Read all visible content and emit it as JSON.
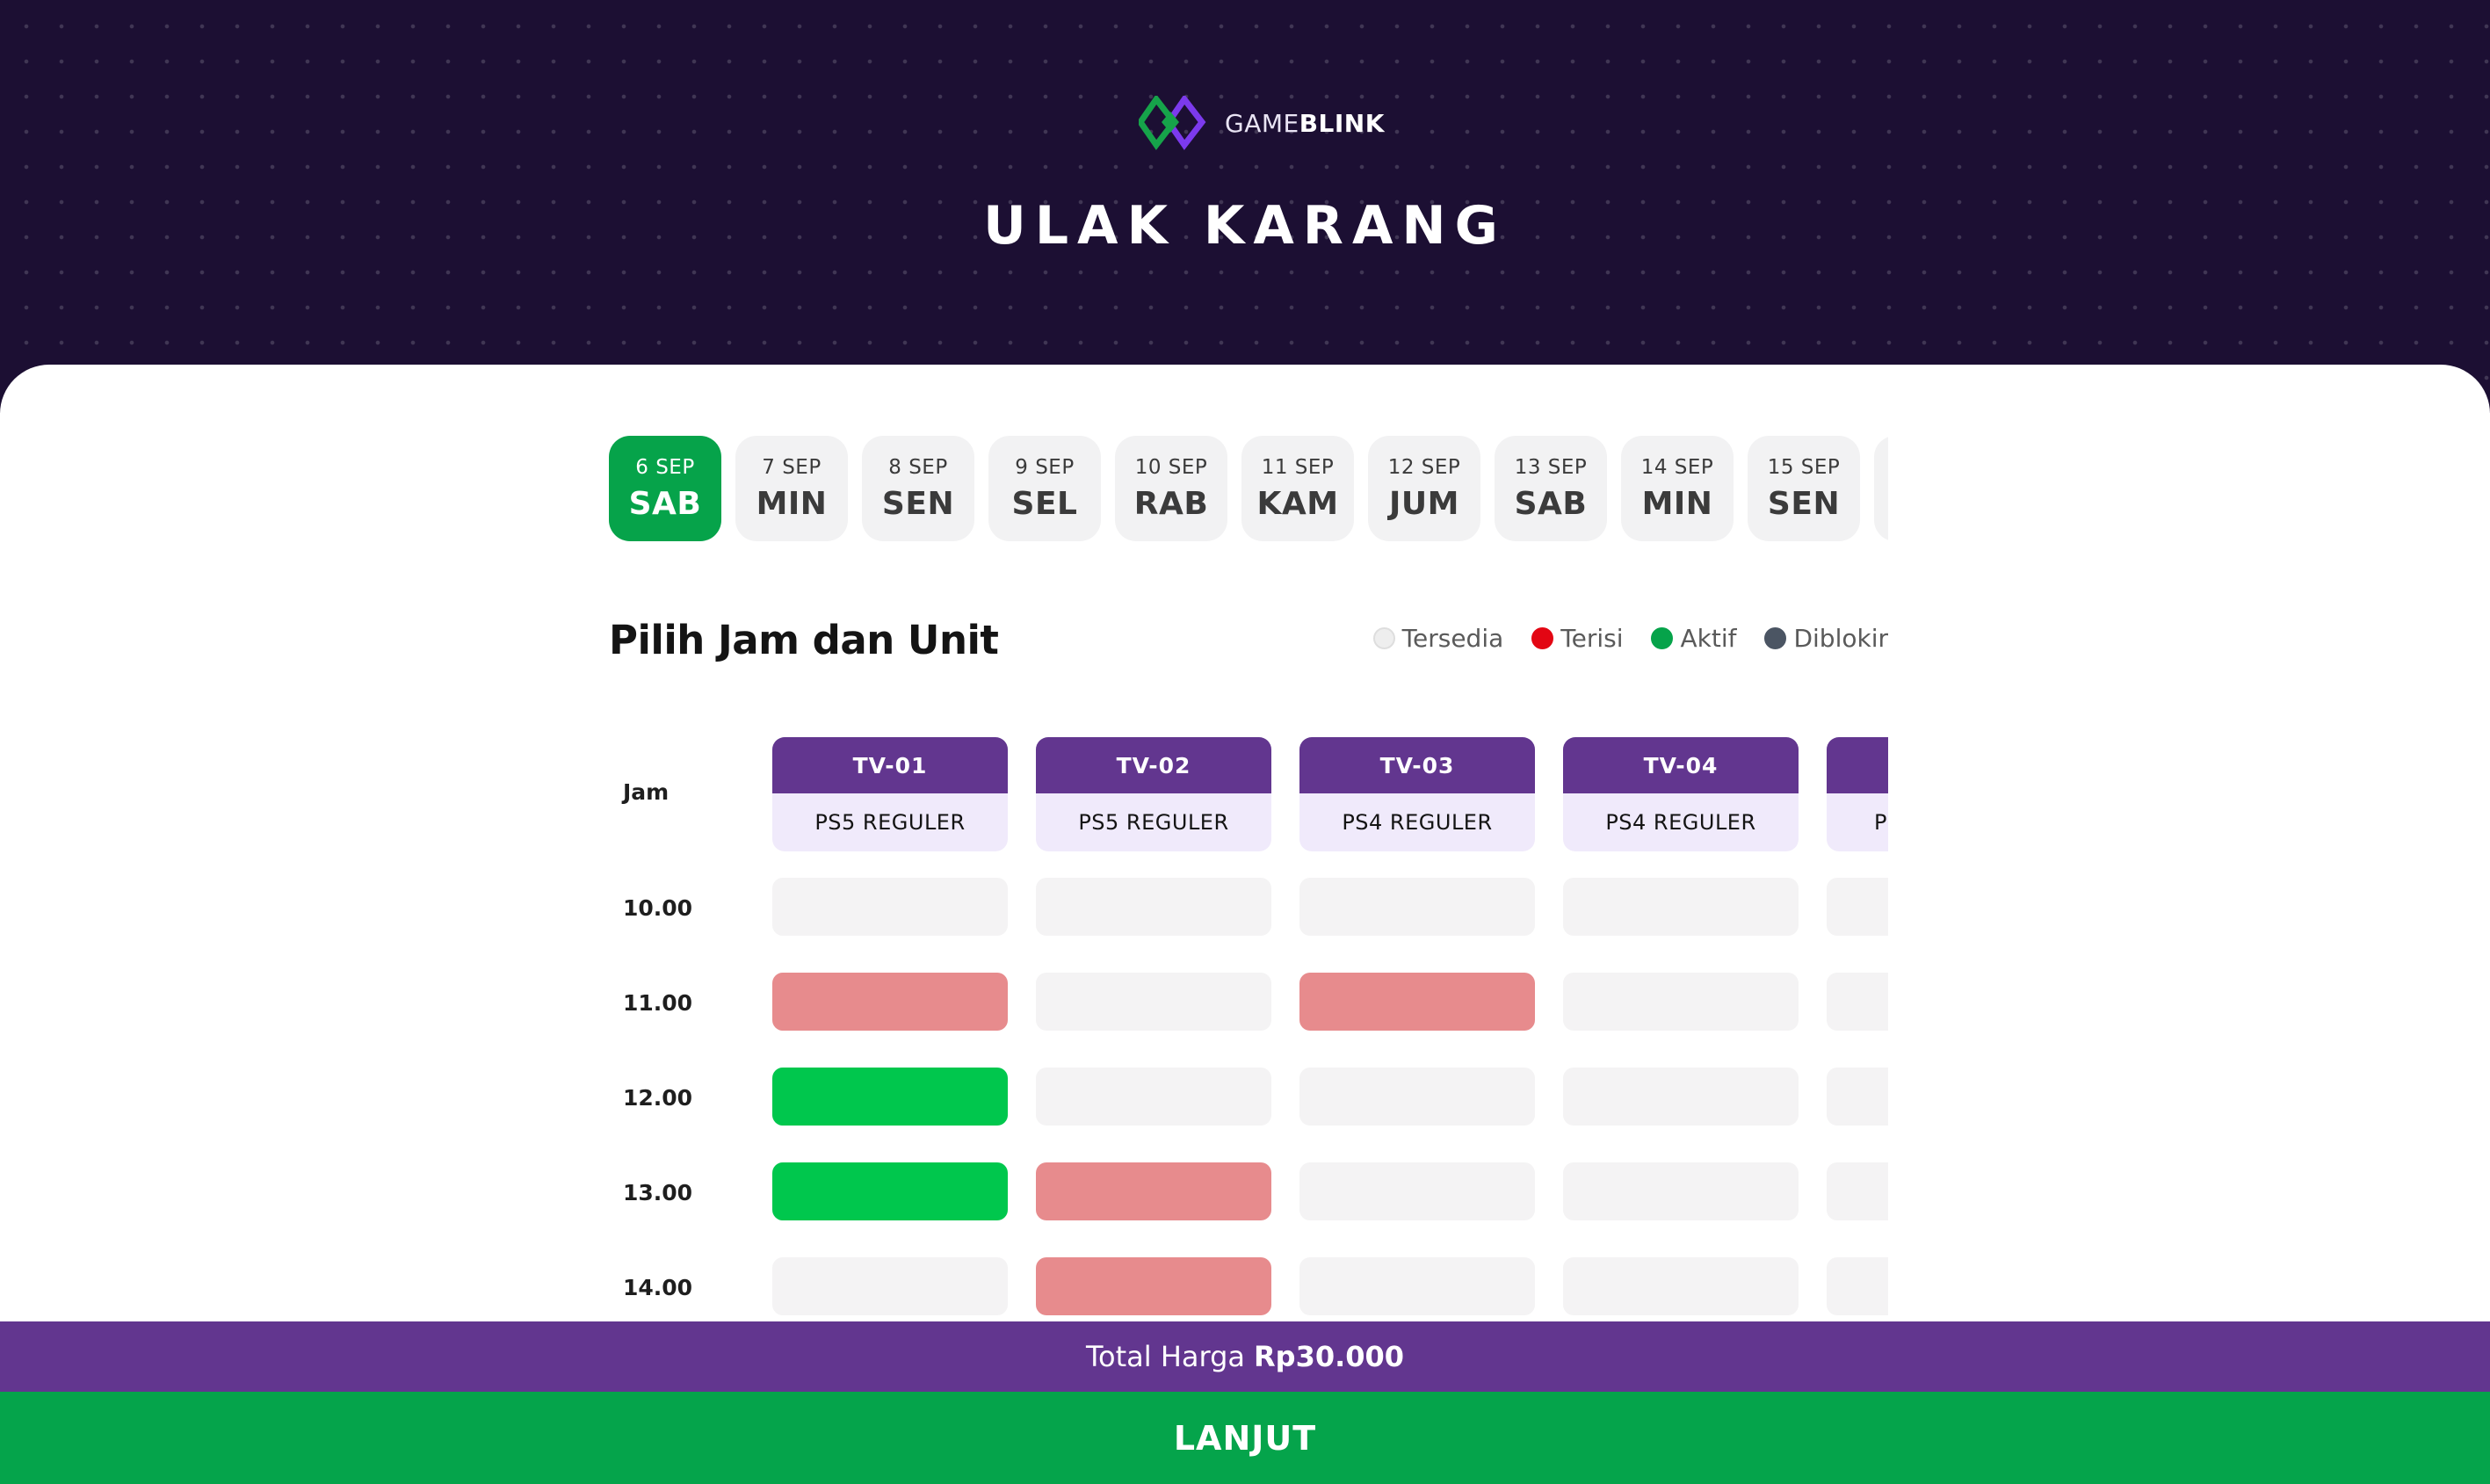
{
  "brand": {
    "name_light": "GAME",
    "name_bold": "BLINK"
  },
  "venue": "ULAK KARANG",
  "dates": [
    {
      "date": "6 SEP",
      "day": "SAB",
      "active": true
    },
    {
      "date": "7 SEP",
      "day": "MIN",
      "active": false
    },
    {
      "date": "8 SEP",
      "day": "SEN",
      "active": false
    },
    {
      "date": "9 SEP",
      "day": "SEL",
      "active": false
    },
    {
      "date": "10 SEP",
      "day": "RAB",
      "active": false
    },
    {
      "date": "11 SEP",
      "day": "KAM",
      "active": false
    },
    {
      "date": "12 SEP",
      "day": "JUM",
      "active": false
    },
    {
      "date": "13 SEP",
      "day": "SAB",
      "active": false
    },
    {
      "date": "14 SEP",
      "day": "MIN",
      "active": false
    },
    {
      "date": "15 SEP",
      "day": "SEN",
      "active": false
    },
    {
      "date": "",
      "day": "",
      "active": false
    }
  ],
  "section_title": "Pilih Jam dan Unit",
  "legend": [
    {
      "label": "Tersedia",
      "color": "#eeeeee",
      "border": "#dedede"
    },
    {
      "label": "Terisi",
      "color": "#e30613",
      "border": "#e30613"
    },
    {
      "label": "Aktif",
      "color": "#06a34a",
      "border": "#06a34a"
    },
    {
      "label": "Diblokir",
      "color": "#4b5563",
      "border": "#4b5563"
    }
  ],
  "grid": {
    "jam_label": "Jam",
    "units": [
      {
        "name": "TV-01",
        "type": "PS5 REGULER"
      },
      {
        "name": "TV-02",
        "type": "PS5 REGULER"
      },
      {
        "name": "TV-03",
        "type": "PS4 REGULER"
      },
      {
        "name": "TV-04",
        "type": "PS4 REGULER"
      },
      {
        "name": "",
        "type": "PS"
      }
    ],
    "times": [
      "10.00",
      "11.00",
      "12.00",
      "13.00",
      "14.00"
    ],
    "slots": [
      [
        "tersedia",
        "tersedia",
        "tersedia",
        "tersedia",
        "tersedia"
      ],
      [
        "terisi",
        "tersedia",
        "terisi",
        "tersedia",
        "tersedia"
      ],
      [
        "aktif",
        "tersedia",
        "tersedia",
        "tersedia",
        "tersedia"
      ],
      [
        "aktif",
        "terisi",
        "tersedia",
        "tersedia",
        "tersedia"
      ],
      [
        "tersedia",
        "terisi",
        "tersedia",
        "tersedia",
        "tersedia"
      ]
    ]
  },
  "footer": {
    "total_label": "Total Harga",
    "total_amount": "Rp30.000",
    "next_label": "LANJUT"
  },
  "colors": {
    "hero_bg": "#1c0f33",
    "accent_purple": "#62368f",
    "accent_green": "#06a34a",
    "slot_terisi": "#e78b8d",
    "slot_aktif": "#00c74d"
  }
}
